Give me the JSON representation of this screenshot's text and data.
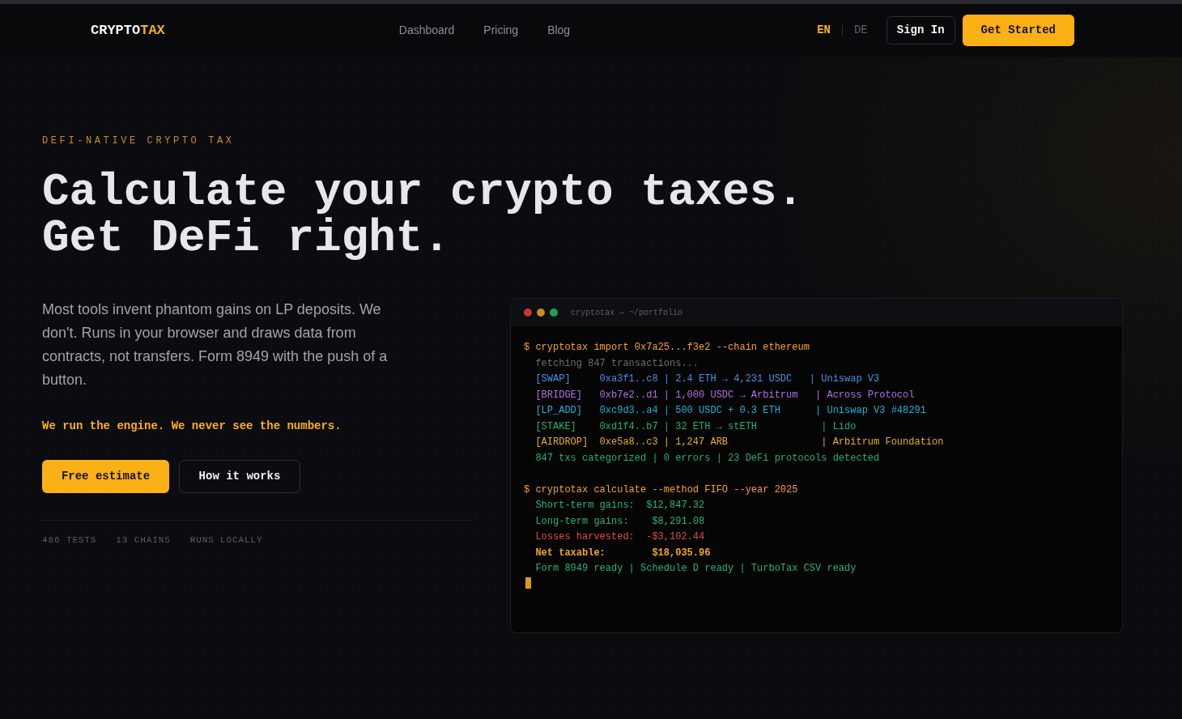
{
  "header": {
    "logo": {
      "text": "CRYPTO",
      "accent": "TAX"
    },
    "nav": [
      "Dashboard",
      "Pricing",
      "Blog"
    ],
    "languages": [
      {
        "label": "EN",
        "selected": true
      },
      {
        "label": "DE",
        "selected": false
      }
    ],
    "sign_in": "Sign In",
    "get_started": "Get Started"
  },
  "hero": {
    "eyebrow": "DEFI-NATIVE CRYPTO TAX",
    "title": "Calculate your crypto taxes. Get DeFi right.",
    "description": "Most tools invent phantom gains on LP deposits. We don't. Runs in your browser and draws data from contracts, not transfers. Form 8949 with the push of a button.",
    "tagline": "We run the engine. We never see the numbers.",
    "buttons": [
      {
        "label": "Free estimate",
        "kind": "primary"
      },
      {
        "label": "How it works",
        "kind": "secondary"
      }
    ],
    "stats": [
      "486 TESTS",
      "13 CHAINS",
      "RUNS LOCALLY"
    ]
  },
  "terminal": {
    "title": "cryptotax — ~/portfolio",
    "blocks": [
      {
        "command": "$ cryptotax import 0x7a25...f3e2 --chain ethereum",
        "lines": [
          {
            "text": "fetching 847 transactions...",
            "color": "#6b6e75",
            "bold": false
          },
          {
            "text": "[SWAP]     0xa3f1..c8 | 2.4 ETH → 4,231 USDC   | Uniswap V3",
            "color": "#4b8fe0",
            "bold": false
          },
          {
            "text": "[BRIDGE]   0xb7e2..d1 | 1,000 USDC → Arbitrum   | Across Protocol",
            "color": "#b36ee0",
            "bold": false
          },
          {
            "text": "[LP_ADD]   0xc9d3..a4 | 500 USDC + 0.3 ETH      | Uniswap V3 #48291",
            "color": "#1ab3d5",
            "bold": false
          },
          {
            "text": "[STAKE]    0xd1f4..b7 | 32 ETH → stETH           | Lido",
            "color": "#20b070",
            "bold": false
          },
          {
            "text": "[AIRDROP]  0xe5a8..c3 | 1,247 ARB                | Arbitrum Foundation",
            "color": "#e0b020",
            "bold": false
          },
          {
            "text": "847 txs categorized | 0 errors | 23 DeFi protocols detected",
            "color": "#20b070",
            "bold": false
          }
        ]
      },
      {
        "command": "$ cryptotax calculate --method FIFO --year 2025",
        "lines": [
          {
            "text": "Short-term gains:  $12,847.32",
            "color": "#1fb57a",
            "bold": false
          },
          {
            "text": "Long-term gains:    $8,291.08",
            "color": "#1fb57a",
            "bold": false
          },
          {
            "text": "Losses harvested:  -$3,102.44",
            "color": "#e04848",
            "bold": false
          },
          {
            "text": "Net taxable:        $18,035.96",
            "color": "#f5a524",
            "bold": true
          },
          {
            "text": "Form 8949 ready | Schedule D ready | TurboTax CSV ready",
            "color": "#1fb57a",
            "bold": false
          }
        ]
      }
    ]
  }
}
